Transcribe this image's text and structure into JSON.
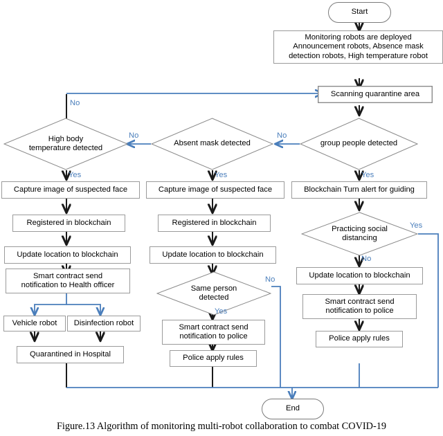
{
  "figure": {
    "caption": "Figure.13 Algorithm of monitoring multi-robot collaboration to combat COVID-19"
  },
  "colors": {
    "flow_black": "#1a1a1a",
    "flow_blue": "#4a7ebb",
    "node_border": "#9a9a9a",
    "background": "#ffffff"
  },
  "nodes": {
    "start": "Start",
    "deploy": "Monitoring robots are deployed Announcement robots, Absence mask detection robots, High temperature robot",
    "deploy_line1": "Monitoring robots are deployed",
    "deploy_line2": "Announcement robots, Absence mask",
    "deploy_line3": "detection robots, High temperature robot",
    "scanning": "Scanning quarantine area",
    "d_group": "group people detected",
    "d_mask": "Absent mask detected",
    "d_temp_line1": "High body",
    "d_temp_line2": "temperature detected",
    "left_capture": "Capture image of suspected  face",
    "left_register": "Registered in blockchain",
    "left_update": "Update location to blockchain",
    "left_contract_line1": "Smart contract send",
    "left_contract_line2": "notification to Health officer",
    "left_vehicle": "Vehicle robot",
    "left_disinfection": "Disinfection robot",
    "left_quarantine": "Quarantined in Hospital",
    "mid_capture": "Capture image of suspected  face",
    "mid_register": "Registered in blockchain",
    "mid_update": "Update location to blockchain",
    "d_same_line1": "Same person",
    "d_same_line2": "detected",
    "mid_contract_line1": "Smart contract send",
    "mid_contract_line2": "notification to police",
    "mid_police": "Police apply rules",
    "right_alert": "Blockchain Turn alert for guiding",
    "d_social_line1": "Practicing social",
    "d_social_line2": "distancing",
    "right_update": "Update location to blockchain",
    "right_contract_line1": "Smart contract send",
    "right_contract_line2": "notification to police",
    "right_police": "Police apply rules",
    "end": "End"
  },
  "edge_labels": {
    "no_loop_left": "No",
    "no_mask_to_temp": "No",
    "no_group_to_mask": "No",
    "yes_temp": "Yes",
    "yes_mask": "Yes",
    "yes_group": "Yes",
    "no_same_person": "No",
    "yes_same_person": "Yes",
    "yes_social": "Yes",
    "no_social": "No"
  }
}
